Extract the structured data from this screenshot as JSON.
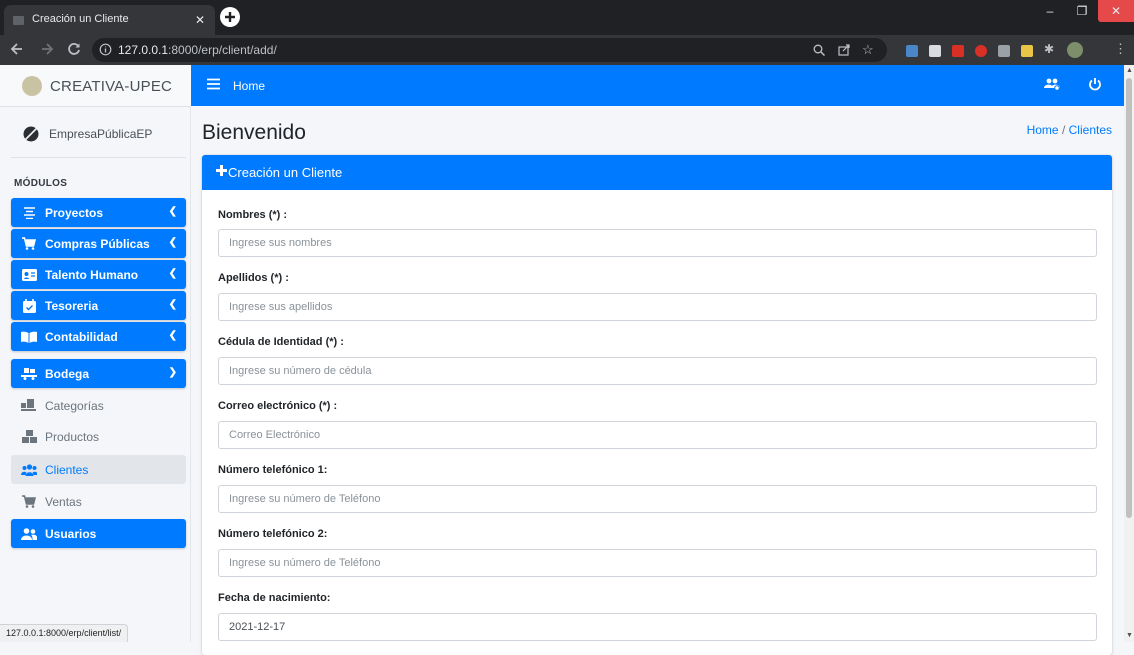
{
  "browser": {
    "tab_title": "Creación un Cliente",
    "url_host": "127.0.0.1",
    "url_rest": ":8000/erp/client/add/"
  },
  "sidebar": {
    "brand": "CREATIVA-UPEC",
    "user": "EmpresaPúblicaEP",
    "section_label": "MÓDULOS",
    "items": [
      {
        "label": "Proyectos",
        "icon": "align-center-icon"
      },
      {
        "label": "Compras Públicas",
        "icon": "cart-icon"
      },
      {
        "label": "Talento Humano",
        "icon": "id-card-icon"
      },
      {
        "label": "Tesoreria",
        "icon": "calendar-check-icon"
      },
      {
        "label": "Contabilidad",
        "icon": "book-open-icon"
      },
      {
        "label": "Bodega",
        "icon": "truck-loading-icon"
      },
      {
        "label": "Categorías",
        "icon": "dolly-icon"
      },
      {
        "label": "Productos",
        "icon": "boxes-icon"
      },
      {
        "label": "Clientes",
        "icon": "users-icon"
      },
      {
        "label": "Ventas",
        "icon": "cart-icon"
      },
      {
        "label": "Usuarios",
        "icon": "user-friends-icon"
      }
    ]
  },
  "navbar": {
    "home_label": "Home"
  },
  "page": {
    "title": "Bienvenido",
    "breadcrumb_home": "Home",
    "breadcrumb_sep": "/",
    "breadcrumb_current": "Clientes"
  },
  "form": {
    "header": "Creación un Cliente",
    "fields": [
      {
        "label": "Nombres (*) :",
        "placeholder": "Ingrese sus nombres",
        "value": ""
      },
      {
        "label": "Apellidos (*) :",
        "placeholder": "Ingrese sus apellidos",
        "value": ""
      },
      {
        "label": "Cédula de Identidad (*) :",
        "placeholder": "Ingrese su número de cédula",
        "value": ""
      },
      {
        "label": "Correo electrónico (*) :",
        "placeholder": "Correo Electrónico",
        "value": ""
      },
      {
        "label": "Número telefónico 1:",
        "placeholder": "Ingrese su número de Teléfono",
        "value": ""
      },
      {
        "label": "Número telefónico 2:",
        "placeholder": "Ingrese su número de Teléfono",
        "value": ""
      },
      {
        "label": "Fecha de nacimiento:",
        "placeholder": "",
        "value": "2021-12-17"
      }
    ]
  },
  "status_bar": "127.0.0.1:8000/erp/client/list/",
  "colors": {
    "primary": "#007bff",
    "chrome_dark": "#202124",
    "chrome_mid": "#35363a"
  }
}
